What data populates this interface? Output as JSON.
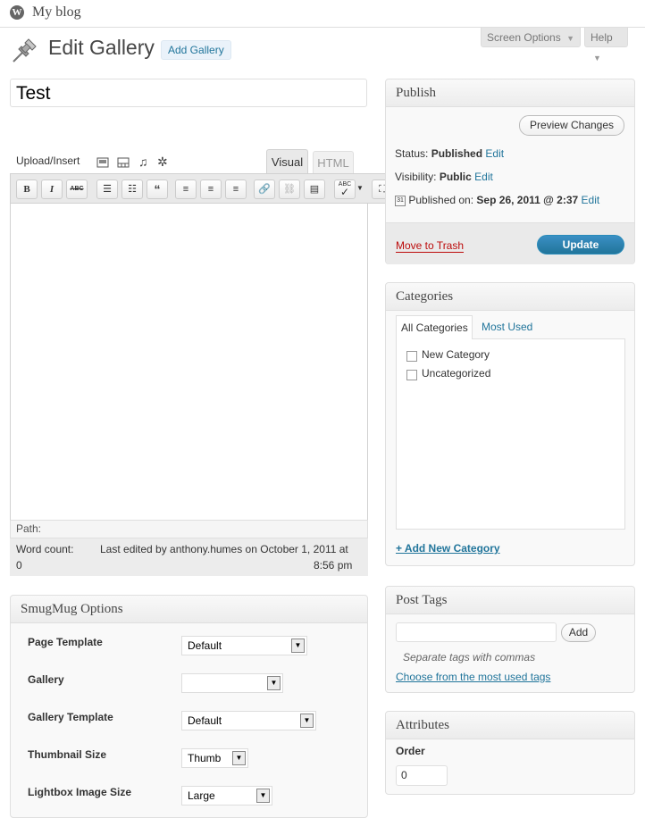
{
  "admin_bar": {
    "site_name": "My blog"
  },
  "header": {
    "title": "Edit Gallery",
    "add_button": "Add Gallery",
    "screen_options": "Screen Options",
    "help": "Help"
  },
  "post": {
    "title": "Test"
  },
  "editor": {
    "upload_label": "Upload/Insert",
    "tab_visual": "Visual",
    "tab_html": "HTML",
    "path_label": "Path:",
    "word_count_label": "Word count:",
    "word_count_value": "0",
    "last_edited_line1": "Last edited by anthony.humes on October 1, 2011 at",
    "last_edited_line2": "8:56 pm"
  },
  "publish": {
    "heading": "Publish",
    "preview_button": "Preview Changes",
    "status_label": "Status:",
    "status_value": "Published",
    "visibility_label": "Visibility:",
    "visibility_value": "Public",
    "published_label": "Published on:",
    "published_value": "Sep 26, 2011 @ 2:37",
    "edit_link": "Edit",
    "trash_link": "Move to Trash",
    "update_button": "Update"
  },
  "categories": {
    "heading": "Categories",
    "tab_all": "All Categories",
    "tab_most_used": "Most Used",
    "items": [
      {
        "label": "New Category"
      },
      {
        "label": "Uncategorized"
      }
    ],
    "add_link": "+ Add New Category"
  },
  "post_tags": {
    "heading": "Post Tags",
    "add_button": "Add",
    "hint": "Separate tags with commas",
    "choose_link": "Choose from the most used tags"
  },
  "attributes": {
    "heading": "Attributes",
    "order_label": "Order",
    "order_value": "0"
  },
  "smugmug": {
    "heading": "SmugMug Options",
    "fields": [
      {
        "label": "Page Template",
        "value": "Default"
      },
      {
        "label": "Gallery",
        "value": ""
      },
      {
        "label": "Gallery Template",
        "value": "Default"
      },
      {
        "label": "Thumbnail Size",
        "value": "Thumb"
      },
      {
        "label": "Lightbox Image Size",
        "value": "Large"
      }
    ]
  }
}
